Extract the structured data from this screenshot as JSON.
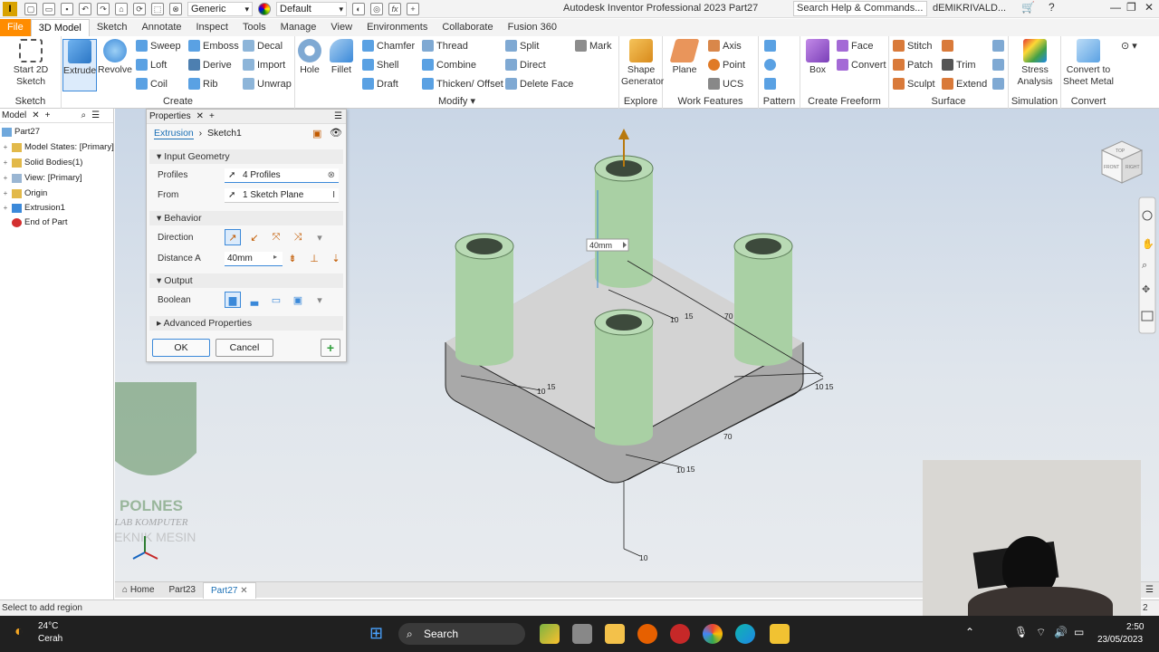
{
  "titlebar": {
    "app_logo": "I",
    "material": "Generic",
    "appearance": "Default",
    "title": "Autodesk Inventor Professional 2023    Part27",
    "search_placeholder": "Search Help & Commands...",
    "user": "dEMIKRIVALD..."
  },
  "tabs": [
    "File",
    "3D Model",
    "Sketch",
    "Annotate",
    "Inspect",
    "Tools",
    "Manage",
    "View",
    "Environments",
    "Collaborate",
    "Fusion 360"
  ],
  "ribbon": {
    "sketch": {
      "title": "Sketch",
      "start_sketch": "Start 2D Sketch"
    },
    "create": {
      "title": "Create",
      "extrude": "Extrude",
      "revolve": "Revolve",
      "sweep": "Sweep",
      "emboss": "Emboss",
      "decal": "Decal",
      "loft": "Loft",
      "derive": "Derive",
      "import": "Import",
      "coil": "Coil",
      "rib": "Rib",
      "unwrap": "Unwrap"
    },
    "modify": {
      "title": "Modify",
      "hole": "Hole",
      "fillet": "Fillet",
      "chamfer": "Chamfer",
      "thread": "Thread",
      "split": "Split",
      "mark": "Mark",
      "shell": "Shell",
      "combine": "Combine",
      "direct": "Direct",
      "draft": "Draft",
      "thicken": "Thicken/ Offset",
      "delete_face": "Delete Face"
    },
    "explore": {
      "title": "Explore",
      "shape_generator": "Shape Generator"
    },
    "work_features": {
      "title": "Work Features",
      "plane": "Plane",
      "axis": "Axis",
      "point": "Point",
      "ucs": "UCS"
    },
    "pattern": {
      "title": "Pattern"
    },
    "freeform": {
      "title": "Create Freeform",
      "box": "Box",
      "face": "Face",
      "convert": "Convert"
    },
    "surface": {
      "title": "Surface",
      "stitch": "Stitch",
      "patch": "Patch",
      "trim": "Trim",
      "sculpt": "Sculpt",
      "extend": "Extend"
    },
    "simulation": {
      "title": "Simulation",
      "stress": "Stress Analysis"
    },
    "convert": {
      "title": "Convert",
      "sheet_metal": "Convert to Sheet Metal"
    }
  },
  "browser": {
    "tab": "Model",
    "items": [
      "Part27",
      "Model States: [Primary]",
      "Solid Bodies(1)",
      "View: [Primary]",
      "Origin",
      "Extrusion1",
      "End of Part"
    ]
  },
  "properties": {
    "tab": "Properties",
    "feature": "Extrusion",
    "sketch": "Sketch1",
    "input_geometry": "Input Geometry",
    "profiles_label": "Profiles",
    "profiles_value": "4 Profiles",
    "from_label": "From",
    "from_value": "1 Sketch Plane",
    "behavior": "Behavior",
    "direction_label": "Direction",
    "distance_label": "Distance A",
    "distance_value": "40mm",
    "output": "Output",
    "boolean_label": "Boolean",
    "advanced": "Advanced Properties",
    "ok": "OK",
    "cancel": "Cancel"
  },
  "viewport": {
    "distance_tag": "40mm",
    "dims": [
      "10",
      "15",
      "70",
      "10",
      "15",
      "10",
      "15",
      "70",
      "10",
      "15",
      "10"
    ],
    "viewcube": {
      "top": "TOP",
      "front": "FRONT",
      "right": "RIGHT"
    },
    "watermark": {
      "line1": "POLNES",
      "line2": "LAB KOMPUTER",
      "line3": "TEKNIK MESIN"
    }
  },
  "doc_tabs": [
    "Home",
    "Part23",
    "Part27"
  ],
  "status": {
    "text": "Select to add region",
    "count": "2"
  },
  "taskbar": {
    "temp": "24°C",
    "weather": "Cerah",
    "search": "Search",
    "time": "2:50",
    "date": "23/05/2023"
  },
  "colors": {
    "file_tab": "#ff8c00",
    "accent": "#3b89d9",
    "cylinder": "#a9d0a4",
    "plate": "#c7c7c7"
  }
}
